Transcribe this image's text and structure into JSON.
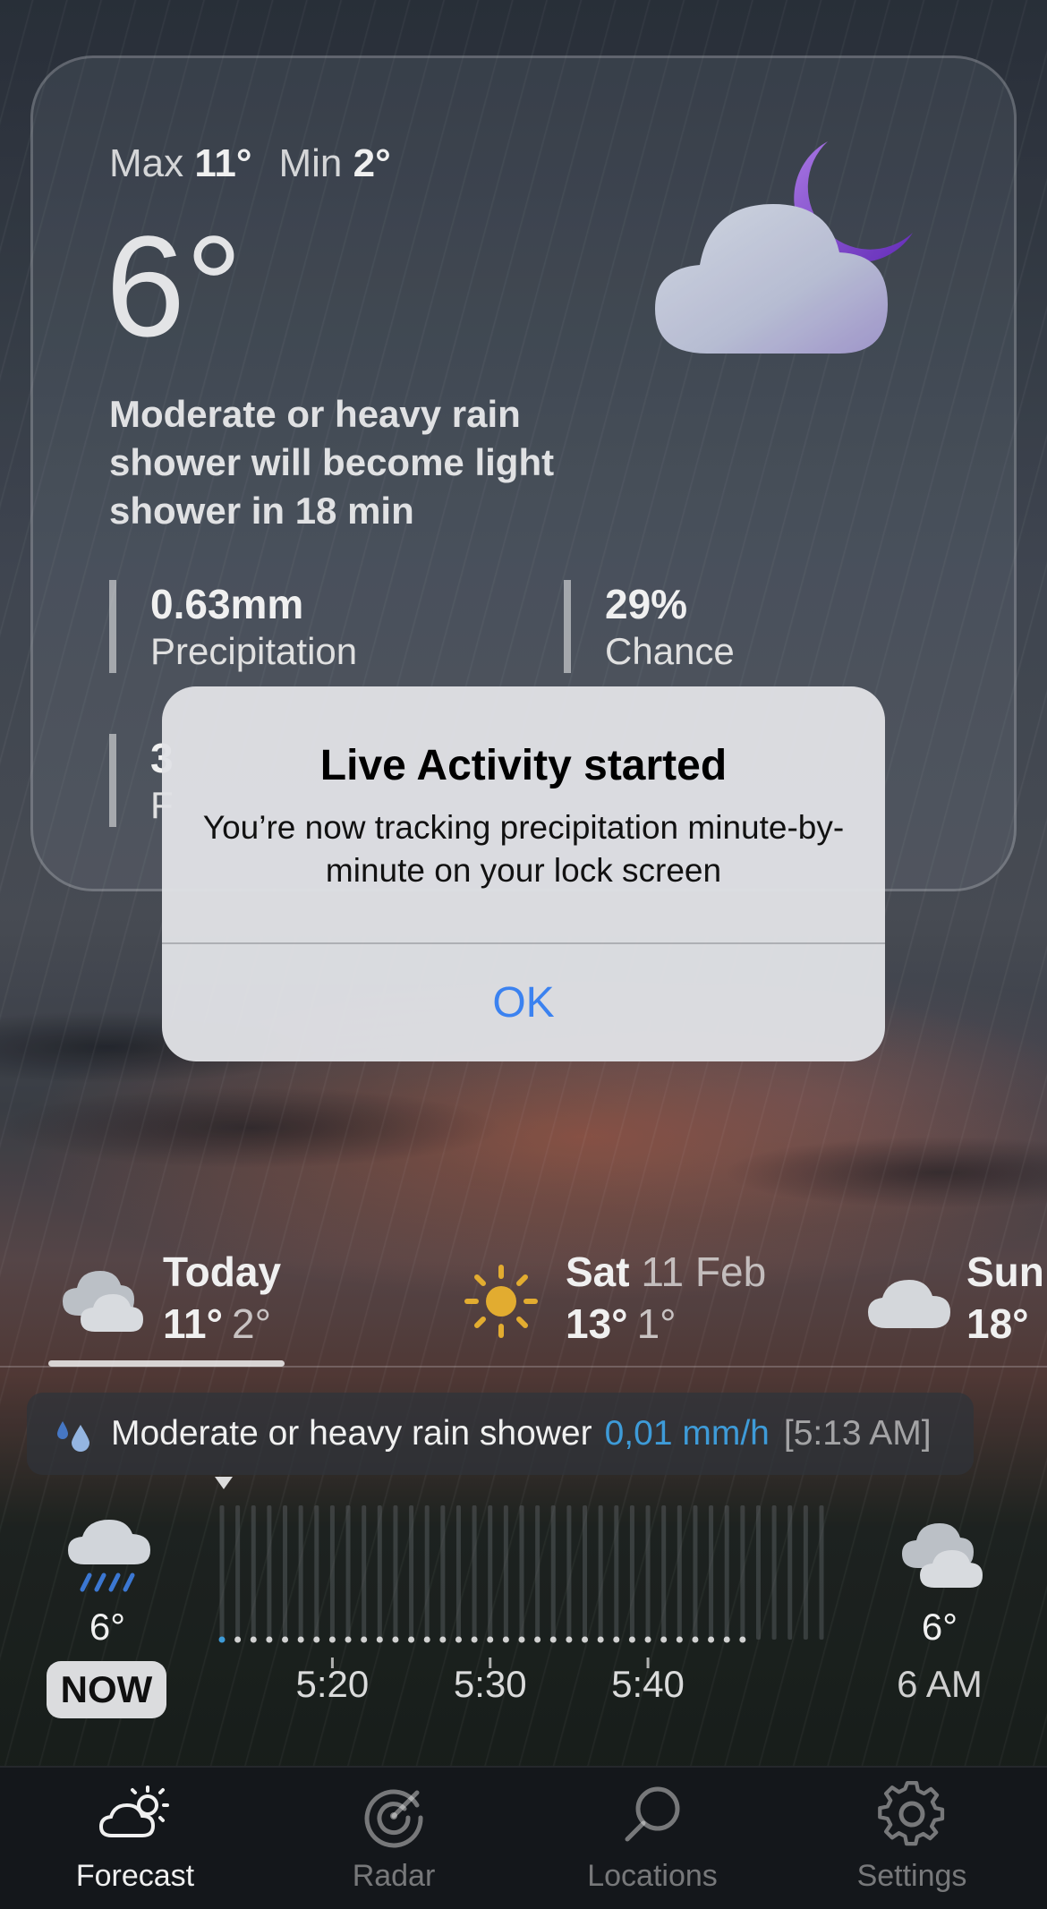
{
  "current": {
    "max_label": "Max",
    "max_value": "11°",
    "min_label": "Min",
    "min_value": "2°",
    "temperature": "6°",
    "summary": "Moderate or heavy rain shower will become light shower in 18 min",
    "icon": "cloud-moon-rain-icon",
    "stats": [
      {
        "value": "0.63mm",
        "label": "Precipitation"
      },
      {
        "value": "29%",
        "label": "Chance"
      },
      {
        "value": "3",
        "label": "F"
      }
    ]
  },
  "alert": {
    "title": "Live Activity started",
    "message": "You’re now tracking precipitation minute-by-minute on your lock screen",
    "ok_label": "OK"
  },
  "daily": [
    {
      "name": "Today",
      "date": "",
      "high": "11°",
      "low": "2°",
      "icon": "cloudy-icon"
    },
    {
      "name": "Sat",
      "date": "11 Feb",
      "high": "13°",
      "low": "1°",
      "icon": "sun-icon"
    },
    {
      "name": "Sun",
      "date": "",
      "high": "18°",
      "low": "",
      "icon": "cloud-icon"
    }
  ],
  "condition": {
    "text": "Moderate or heavy rain shower",
    "rate": "0,01 mm/h",
    "time": "[5:13 AM]",
    "icon": "rain-drops-icon"
  },
  "minute_forecast": {
    "now_temp": "6°",
    "now_label": "NOW",
    "now_icon": "cloud-rain-icon",
    "later_temp": "6°",
    "later_time": "6 AM",
    "later_icon": "cloudy-icon",
    "tick_labels": [
      "5:20",
      "5:30",
      "5:40"
    ],
    "tick_minutes": [
      7,
      17,
      27
    ],
    "total_minutes": 38,
    "precip_minutes": 33,
    "accent": "#42a5e6"
  },
  "tabs": [
    {
      "label": "Forecast",
      "icon": "forecast-icon",
      "active": true
    },
    {
      "label": "Radar",
      "icon": "radar-icon",
      "active": false
    },
    {
      "label": "Locations",
      "icon": "search-icon",
      "active": false
    },
    {
      "label": "Settings",
      "icon": "gear-icon",
      "active": false
    }
  ]
}
